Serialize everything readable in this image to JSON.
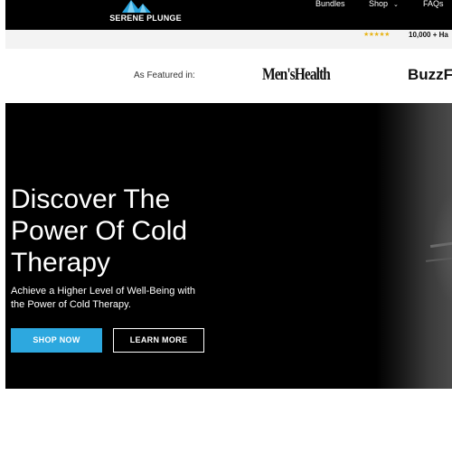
{
  "header": {
    "brand": "SERENE PLUNGE",
    "logo_icon": "mountain-triangle-icon",
    "nav": [
      {
        "label": "Bundles"
      },
      {
        "label": "Shop"
      },
      {
        "label": "FAQs"
      }
    ],
    "shop_chevron_icon": "chevron-down-icon"
  },
  "rating_bar": {
    "stars": "★★★★★",
    "text": "10,000 + Ha"
  },
  "featured": {
    "label": "As Featured in:",
    "logos": [
      "Men'sHealth",
      "BuzzF"
    ]
  },
  "hero": {
    "title": "Discover The Power Of Cold Therapy",
    "subtitle": "Achieve a Higher Level of Well-Being with the Power of Cold Therapy.",
    "primary_button": "SHOP NOW",
    "secondary_button": "LEARN MORE"
  },
  "colors": {
    "accent": "#2da8df",
    "star": "#e8b417",
    "hero_bg": "#000000",
    "header_bg": "#000000",
    "rating_bar_bg": "#f3f3f3"
  }
}
